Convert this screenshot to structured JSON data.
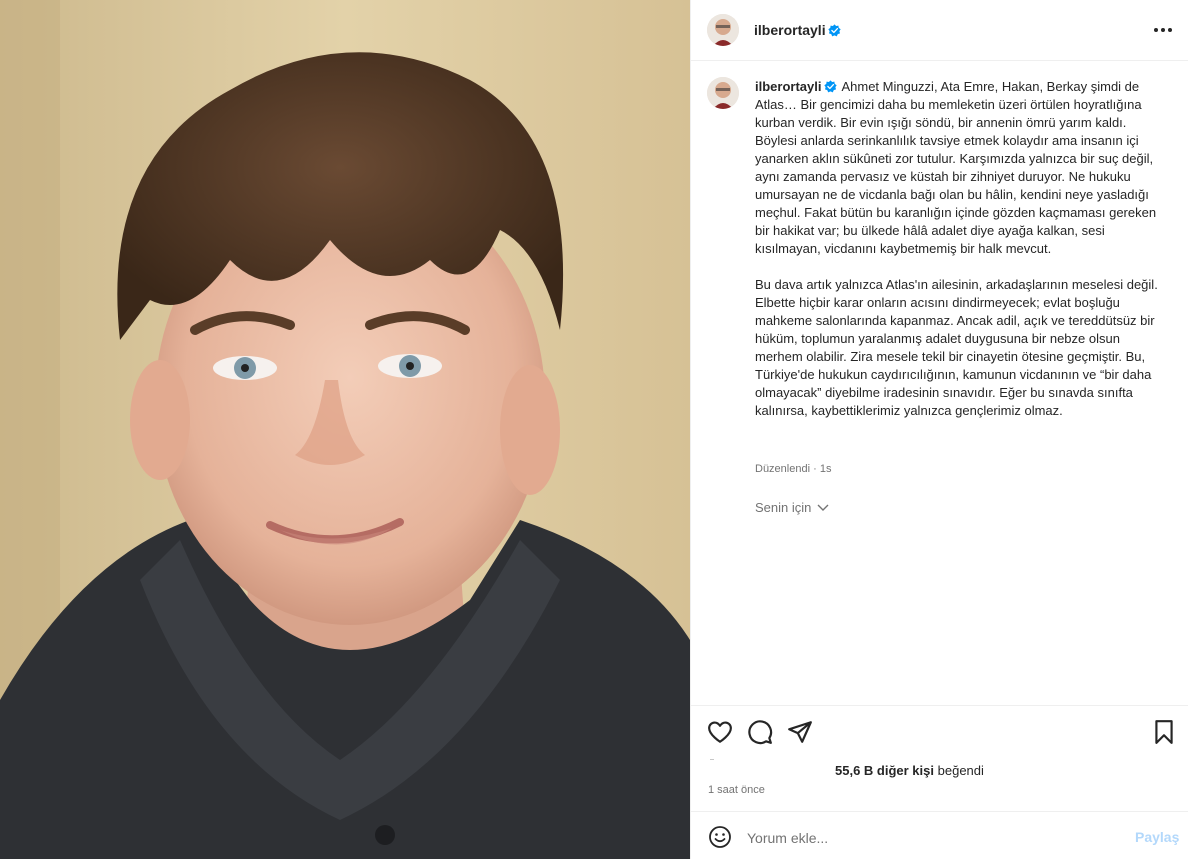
{
  "post": {
    "username": "ilberortayli",
    "verified": true,
    "caption": {
      "paragraph1": "Ahmet Minguzzi, Ata Emre, Hakan, Berkay şimdi de Atlas… Bir gencimizi daha bu memleketin üzeri örtülen hoyratlığına kurban verdik. Bir evin ışığı söndü, bir annenin ömrü yarım kaldı. Böylesi anlarda serinkanlılık tavsiye etmek kolaydır ama insanın içi yanarken aklın sükûneti zor tutulur. Karşımızda yalnızca bir suç değil, aynı zamanda pervasız ve küstah bir zihniyet duruyor. Ne hukuku umursayan ne de vicdanla bağı olan bu hâlin, kendini neye yasladığı meçhul. Fakat bütün bu karanlığın içinde gözden kaçmaması gereken bir hakikat var; bu ülkede hâlâ adalet diye ayağa kalkan, sesi kısılmayan, vicdanını kaybetmemiş bir halk mevcut.",
      "paragraph2": "Bu dava artık yalnızca Atlas'ın ailesinin, arkadaşlarının meselesi değil. Elbette hiçbir karar onların acısını dindirmeyecek; evlat boşluğu mahkeme salonlarında kapanmaz. Ancak adil, açık ve tereddütsüz bir hüküm, toplumun yaralanmış adalet duygusuna bir nebze olsun merhem olabilir. Zira mesele tekil bir cinayetin ötesine geçmiştir. Bu, Türkiye'de hukukun caydırıcılığının, kamunun vicdanının ve “bir daha olmayacak” diyebilme iradesinin sınavıdır. Eğer bu sınavda sınıfta kalınırsa, kaybettiklerimiz yalnızca gençlerimiz olmaz."
    },
    "edited_label": "Düzenlendi",
    "edited_sep": "·",
    "edited_time": "1s",
    "for_you_label": "Senin için",
    "likes_count": "55,6 B diğer kişi",
    "likes_suffix": "beğendi",
    "posted_time": "1 saat önce"
  },
  "comment": {
    "placeholder": "Yorum ekle...",
    "post_label": "Paylaş"
  },
  "colors": {
    "verified": "#0095f6",
    "muted": "#737373",
    "post_button_disabled": "#b3d8fb"
  },
  "icons": [
    "more-options-icon",
    "verified-badge-icon",
    "heart-icon",
    "comment-icon",
    "share-icon",
    "bookmark-icon",
    "emoji-icon",
    "chevron-down-icon"
  ]
}
